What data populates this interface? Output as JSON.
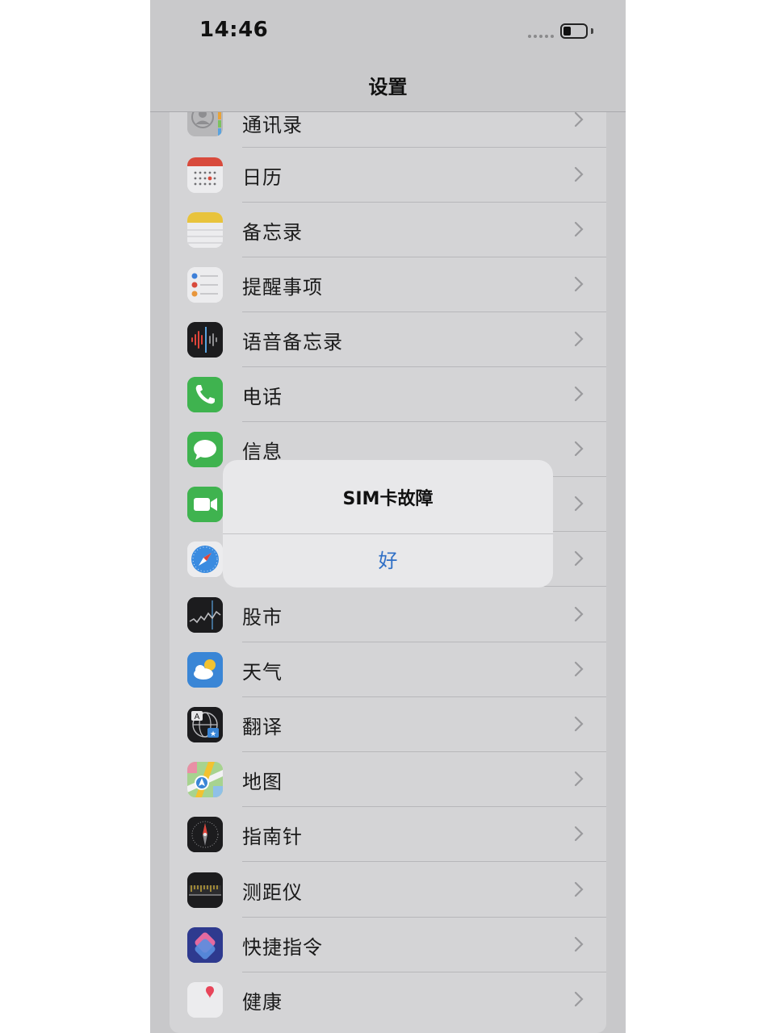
{
  "status_bar": {
    "time": "14:46"
  },
  "nav": {
    "title": "设置"
  },
  "settings_items": [
    {
      "label": "通讯录",
      "icon": "contacts-icon"
    },
    {
      "label": "日历",
      "icon": "calendar-icon"
    },
    {
      "label": "备忘录",
      "icon": "notes-icon"
    },
    {
      "label": "提醒事项",
      "icon": "reminders-icon"
    },
    {
      "label": "语音备忘录",
      "icon": "voice-memos-icon"
    },
    {
      "label": "电话",
      "icon": "phone-icon"
    },
    {
      "label": "信息",
      "icon": "messages-icon"
    },
    {
      "label": "",
      "icon": "facetime-icon"
    },
    {
      "label": "",
      "icon": "safari-icon"
    },
    {
      "label": "股市",
      "icon": "stocks-icon"
    },
    {
      "label": "天气",
      "icon": "weather-icon"
    },
    {
      "label": "翻译",
      "icon": "translate-icon"
    },
    {
      "label": "地图",
      "icon": "maps-icon"
    },
    {
      "label": "指南针",
      "icon": "compass-icon"
    },
    {
      "label": "测距仪",
      "icon": "measure-icon"
    },
    {
      "label": "快捷指令",
      "icon": "shortcuts-icon"
    },
    {
      "label": "健康",
      "icon": "health-icon"
    }
  ],
  "alert": {
    "title": "SIM卡故障",
    "button_label": "好"
  },
  "colors": {
    "alert_button": "#2f6fc6",
    "background": "#c8c8ca"
  }
}
